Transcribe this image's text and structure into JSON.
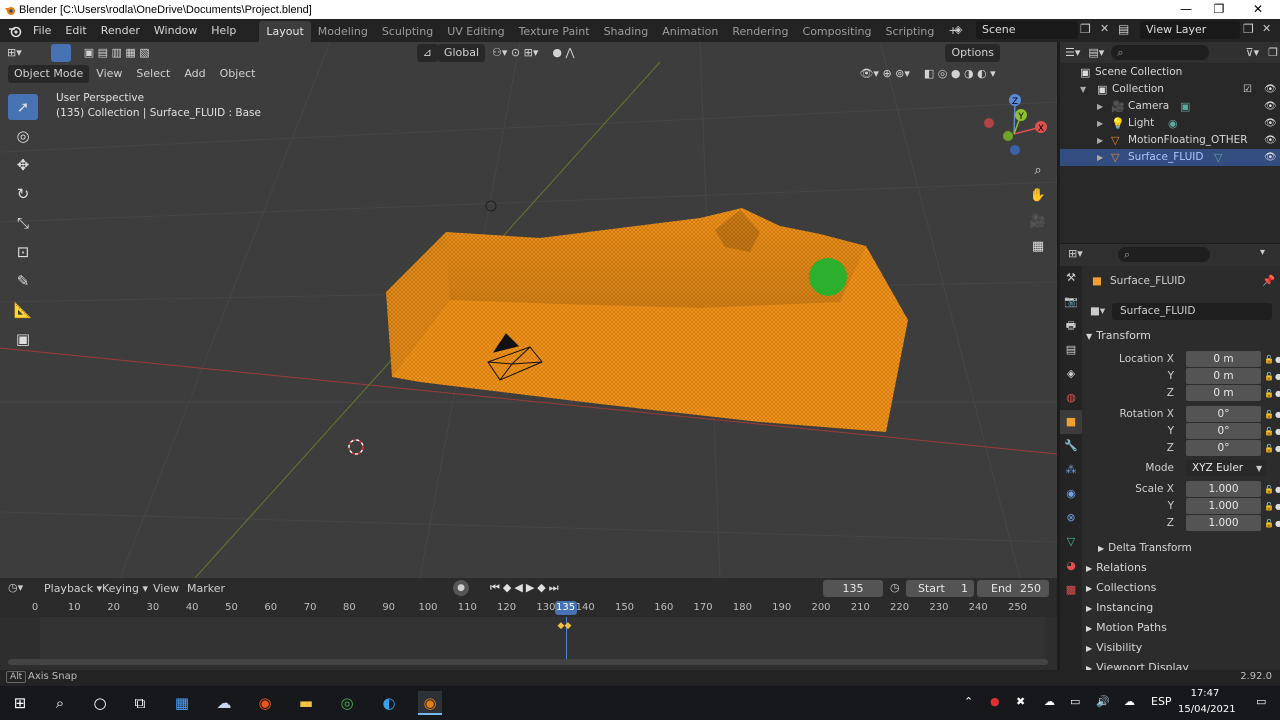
{
  "window": {
    "title": "Blender [C:\\Users\\rodla\\OneDrive\\Documents\\Project.blend]",
    "min": "—",
    "max": "❐",
    "close": "✕"
  },
  "menubar": {
    "items": [
      "File",
      "Edit",
      "Render",
      "Window",
      "Help"
    ],
    "workspaces": [
      "Layout",
      "Modeling",
      "Sculpting",
      "UV Editing",
      "Texture Paint",
      "Shading",
      "Animation",
      "Rendering",
      "Compositing",
      "Scripting"
    ],
    "add_workspace": "+",
    "scene": "Scene",
    "view_layer": "View Layer"
  },
  "viewport": {
    "transform_orientation": "Global",
    "options": "Options",
    "mode": "Object Mode",
    "menu": [
      "View",
      "Select",
      "Add",
      "Object"
    ],
    "info_line1": "User Perspective",
    "info_line2": "(135) Collection | Surface_FLUID : Base",
    "gizmo": {
      "x": "X",
      "y": "Y",
      "z": "Z"
    }
  },
  "outliner": {
    "root": "Scene Collection",
    "collection": "Collection",
    "items": [
      "Camera",
      "Light",
      "MotionFloating_OTHER",
      "Surface_FLUID"
    ]
  },
  "properties": {
    "object_name": "Surface_FLUID",
    "data_name": "Surface_FLUID",
    "transform_title": "Transform",
    "location_label": "Location X",
    "rotation_label": "Rotation X",
    "scale_label": "Scale X",
    "axis_y": "Y",
    "axis_z": "Z",
    "location": [
      "0 m",
      "0 m",
      "0 m"
    ],
    "rotation": [
      "0°",
      "0°",
      "0°"
    ],
    "mode_label": "Mode",
    "mode_value": "XYZ Euler",
    "scale": [
      "1.000",
      "1.000",
      "1.000"
    ],
    "delta_transform": "Delta Transform",
    "panels": [
      "Relations",
      "Collections",
      "Instancing",
      "Motion Paths",
      "Visibility",
      "Viewport Display"
    ]
  },
  "timeline": {
    "menus": [
      "Playback",
      "Keying",
      "View",
      "Marker"
    ],
    "current_frame": "135",
    "start_label": "Start",
    "start_value": "1",
    "end_label": "End",
    "end_value": "250",
    "ticks": [
      "0",
      "10",
      "20",
      "30",
      "40",
      "50",
      "60",
      "70",
      "80",
      "90",
      "100",
      "110",
      "120",
      "130",
      "140",
      "150",
      "160",
      "170",
      "180",
      "190",
      "200",
      "210",
      "220",
      "230",
      "240",
      "250"
    ],
    "playhead": "135"
  },
  "status": {
    "left_key": "Alt",
    "left_text": "Axis Snap",
    "version": "2.92.0"
  },
  "taskbar": {
    "lang": "ESP",
    "time": "17:47",
    "date": "15/04/2021"
  }
}
